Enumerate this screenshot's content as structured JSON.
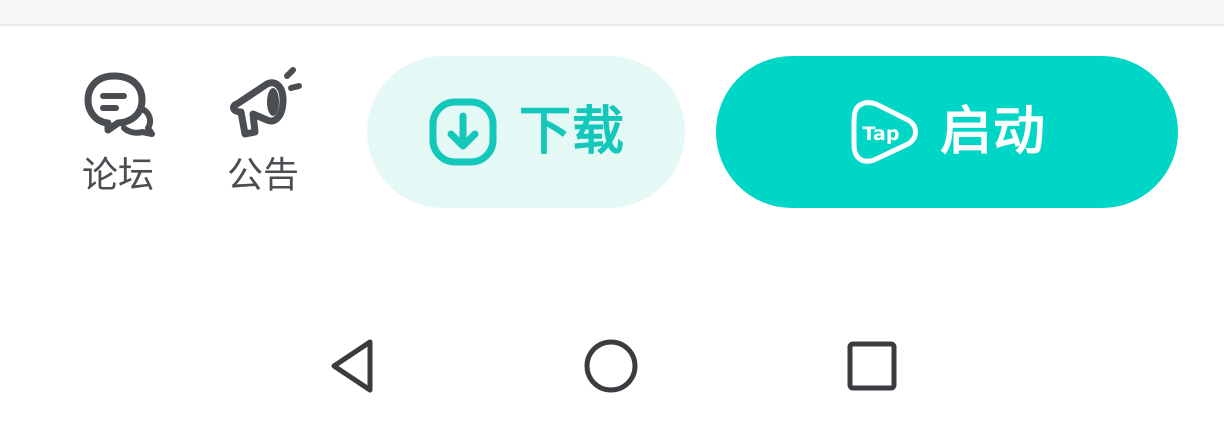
{
  "actions": {
    "forum": {
      "label": "论坛",
      "icon": "forum-chat-icon"
    },
    "notice": {
      "label": "公告",
      "icon": "megaphone-icon"
    },
    "download": {
      "label": "下载",
      "icon": "download-arrow-icon"
    },
    "launch": {
      "label": "启动",
      "icon": "tap-logo-icon",
      "icon_text": "Tap"
    }
  },
  "nav": {
    "back": {
      "icon": "back-triangle-icon"
    },
    "home": {
      "icon": "home-circle-icon"
    },
    "recent": {
      "icon": "recent-square-icon"
    }
  },
  "colors": {
    "accent": "#00d6c6",
    "accent_light": "#e4f8f6",
    "icon_gray": "#4a4d52",
    "nav_gray": "#3a3c40"
  }
}
